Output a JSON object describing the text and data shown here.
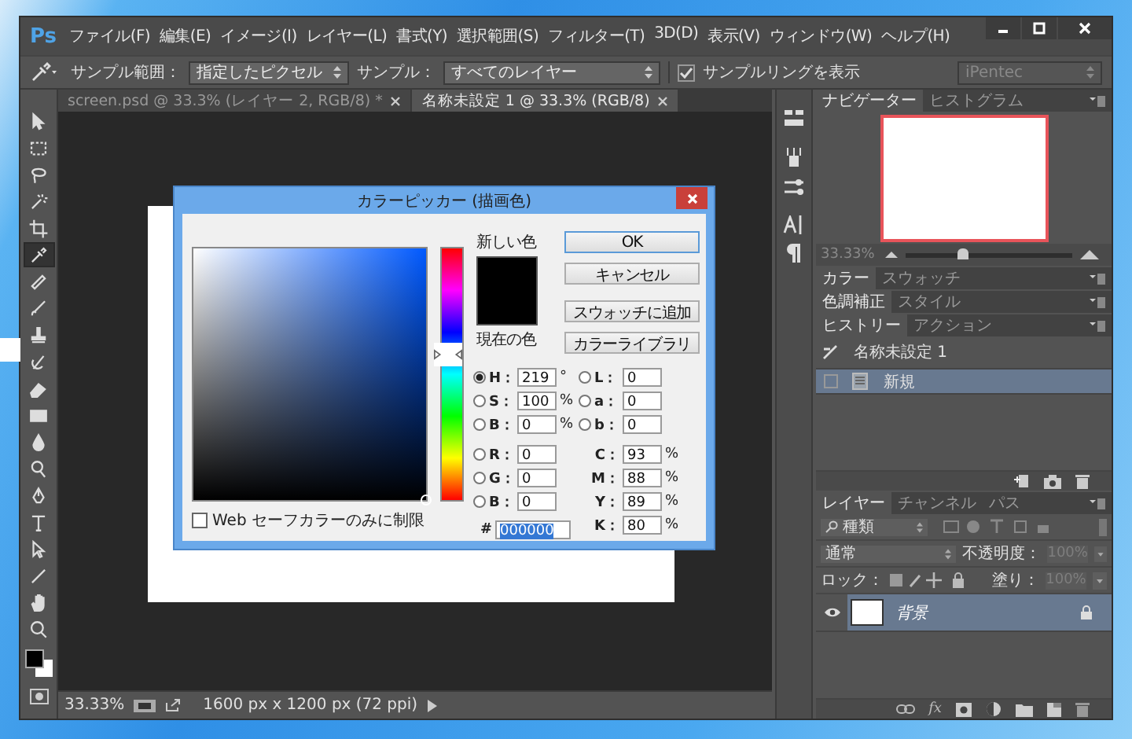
{
  "app": {
    "logo": "Ps"
  },
  "menu": [
    "ファイル(F)",
    "編集(E)",
    "イメージ(I)",
    "レイヤー(L)",
    "書式(Y)",
    "選択範囲(S)",
    "フィルター(T)",
    "3D(D)",
    "表示(V)",
    "ウィンドウ(W)",
    "ヘルプ(H)"
  ],
  "options_bar": {
    "sample_size_label": "サンプル範囲：",
    "sample_size": "指定したピクセル",
    "sample_label": "サンプル：",
    "sample": "すべてのレイヤー",
    "show_ring": {
      "label": "サンプルリングを表示",
      "checked": true
    },
    "workspace": "iPentec"
  },
  "document_tabs": [
    {
      "label": "screen.psd @ 33.3% (レイヤー 2, RGB/8) *",
      "selected": false
    },
    {
      "label": "名称未設定 1 @ 33.3% (RGB/8)",
      "selected": true
    }
  ],
  "tools": [
    {
      "kind": "move",
      "selected": false
    },
    {
      "kind": "marquee",
      "selected": false
    },
    {
      "kind": "lasso",
      "selected": false
    },
    {
      "kind": "wand",
      "selected": false
    },
    {
      "kind": "crop",
      "selected": false
    },
    {
      "kind": "eyedropper",
      "selected": true
    },
    {
      "kind": "healing",
      "selected": false
    },
    {
      "kind": "brush",
      "selected": false
    },
    {
      "kind": "stamp",
      "selected": false
    },
    {
      "kind": "history",
      "selected": false
    },
    {
      "kind": "eraser",
      "selected": false
    },
    {
      "kind": "gradient",
      "selected": false
    },
    {
      "kind": "blur",
      "selected": false
    },
    {
      "kind": "dodge",
      "selected": false
    },
    {
      "kind": "pen",
      "selected": false
    },
    {
      "kind": "type",
      "selected": false
    },
    {
      "kind": "path",
      "selected": false
    },
    {
      "kind": "line",
      "selected": false
    },
    {
      "kind": "hand",
      "selected": false
    },
    {
      "kind": "zoom",
      "selected": false
    }
  ],
  "status_bar": {
    "zoom": "33.33%",
    "doc_info": "1600 px x 1200 px (72 ppi)"
  },
  "color_picker": {
    "title": "カラーピッカー (描画色)",
    "new_label": "新しい色",
    "current_label": "現在の色",
    "buttons": [
      "OK",
      "キャンセル",
      "スウォッチに追加",
      "カラーライブラリ"
    ],
    "left_fields": [
      {
        "label": "H：",
        "value": "219",
        "unit": "°",
        "selected": true
      },
      {
        "label": "S：",
        "value": "100",
        "unit": "%",
        "selected": false
      },
      {
        "label": "B：",
        "value": "0",
        "unit": "%",
        "selected": false
      },
      {
        "label": "R：",
        "value": "0",
        "selected": false
      },
      {
        "label": "G：",
        "value": "0",
        "selected": false
      },
      {
        "label": "B：",
        "value": "0",
        "selected": false
      }
    ],
    "right_fields": [
      {
        "kind": "radio",
        "label": "L：",
        "value": "0",
        "selected": false
      },
      {
        "kind": "radio",
        "label": "a：",
        "value": "0",
        "selected": false
      },
      {
        "kind": "radio",
        "label": "b：",
        "value": "0",
        "selected": false
      },
      {
        "kind": "plain",
        "label": "C：",
        "value": "93",
        "unit": "%"
      },
      {
        "kind": "plain",
        "label": "M：",
        "value": "88",
        "unit": "%"
      },
      {
        "kind": "plain",
        "label": "Y：",
        "value": "89",
        "unit": "%"
      },
      {
        "kind": "plain",
        "label": "K：",
        "value": "80",
        "unit": "%"
      }
    ],
    "hex_label": "#",
    "hex": "000000",
    "web_safe": {
      "label": "Web セーフカラーのみに制限",
      "checked": false
    }
  },
  "panels": {
    "navigator": {
      "tabs": [
        {
          "label": "ナビゲーター",
          "selected": true
        },
        {
          "label": "ヒストグラム",
          "selected": false
        }
      ],
      "zoom": "33.33%",
      "zoom_slider": {
        "level": 0.34
      }
    },
    "collapsed": [
      {
        "tabs": [
          {
            "label": "カラー",
            "selected": true
          },
          {
            "label": "スウォッチ",
            "selected": false
          }
        ]
      },
      {
        "tabs": [
          {
            "label": "色調補正",
            "selected": true
          },
          {
            "label": "スタイル",
            "selected": false
          }
        ]
      }
    ],
    "history": {
      "tabs": [
        {
          "label": "ヒストリー",
          "selected": true
        },
        {
          "label": "アクション",
          "selected": false
        }
      ],
      "items": [
        {
          "kind": "snapshot",
          "label": "名称未設定 1",
          "selected": false
        },
        {
          "kind": "step",
          "label": "新規",
          "selected": true
        }
      ]
    },
    "layers": {
      "tabs": [
        {
          "label": "レイヤー",
          "selected": true
        },
        {
          "label": "チャンネル",
          "selected": false
        },
        {
          "label": "パス",
          "selected": false
        }
      ],
      "filter": "種類",
      "blend_mode": "通常",
      "opacity_label": "不透明度：",
      "opacity": "100%",
      "lock_label": "ロック：",
      "fill_label": "塗り：",
      "fill": "100%",
      "fx": "fx",
      "items": [
        {
          "name": "背景",
          "selected": true,
          "visible": true,
          "locked": true
        }
      ]
    }
  }
}
